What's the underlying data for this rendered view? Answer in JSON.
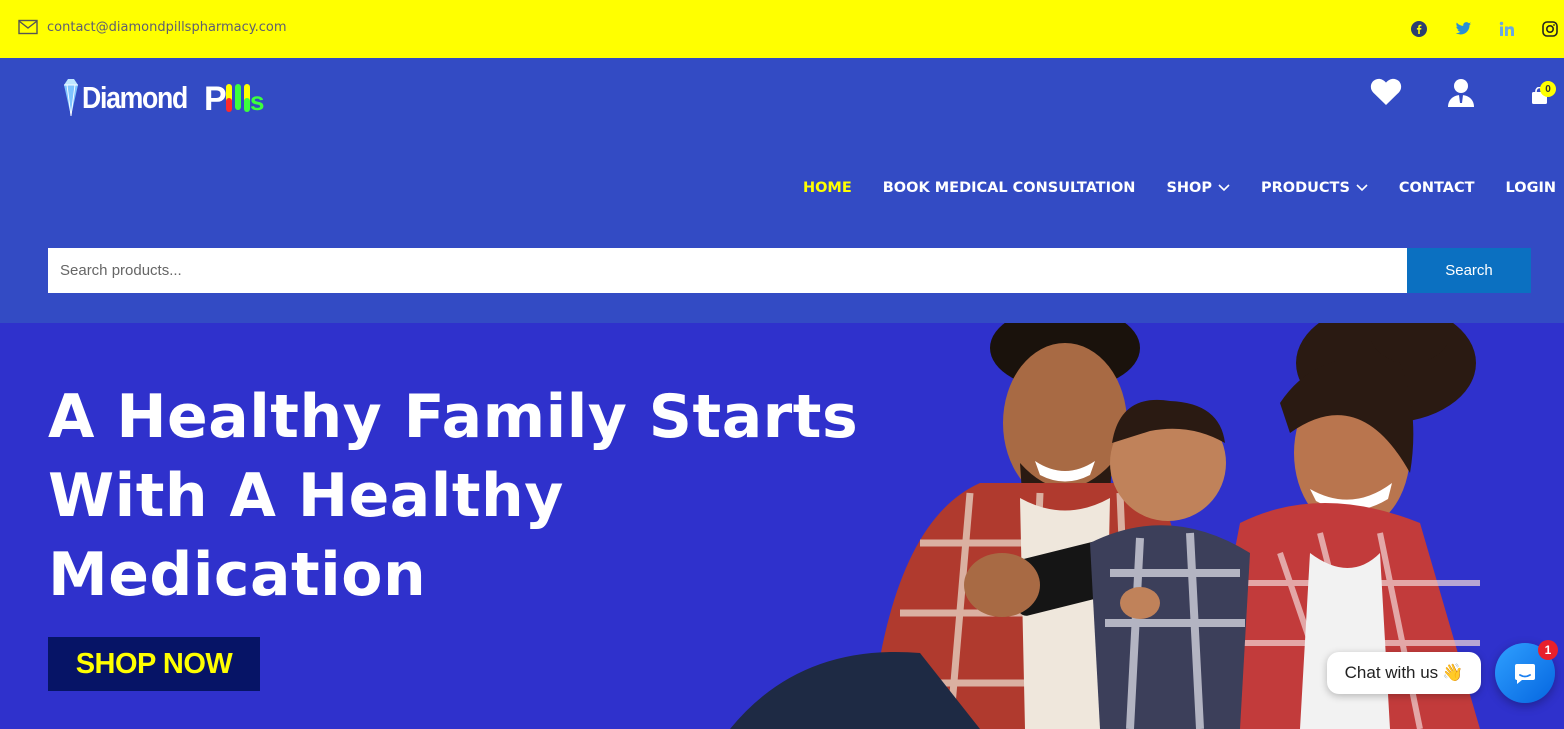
{
  "topbar": {
    "email": "contact@diamondpillspharmacy.com",
    "social": [
      "facebook-icon",
      "twitter-icon",
      "linkedin-icon",
      "instagram-icon"
    ]
  },
  "brand": {
    "name_part1": "Diamond",
    "name_part2": "Pills",
    "accent_colors": [
      "#ff2a2a",
      "#ffff00",
      "#3cff3c"
    ]
  },
  "header": {
    "cart_count": "0"
  },
  "nav": {
    "items": [
      {
        "label": "HOME",
        "active": true
      },
      {
        "label": "BOOK MEDICAL CONSULTATION"
      },
      {
        "label": "SHOP",
        "dropdown": true
      },
      {
        "label": "PRODUCTS",
        "dropdown": true
      },
      {
        "label": "CONTACT"
      },
      {
        "label": "LOGIN"
      }
    ]
  },
  "search": {
    "placeholder": "Search products...",
    "button_label": "Search"
  },
  "hero": {
    "heading": "A Healthy Family Starts With A Healthy Medication",
    "cta_label": "SHOP NOW"
  },
  "chat": {
    "bubble_text": "Chat with us",
    "emoji": "👋",
    "unread": "1"
  },
  "colors": {
    "topbar_bg": "#ffff00",
    "header_bg": "#334bc4",
    "hero_bg": "#2f31cc",
    "nav_active": "#ffff00",
    "search_button": "#0b70c1",
    "cta_bg": "#061466",
    "cta_text": "#ffff00"
  }
}
